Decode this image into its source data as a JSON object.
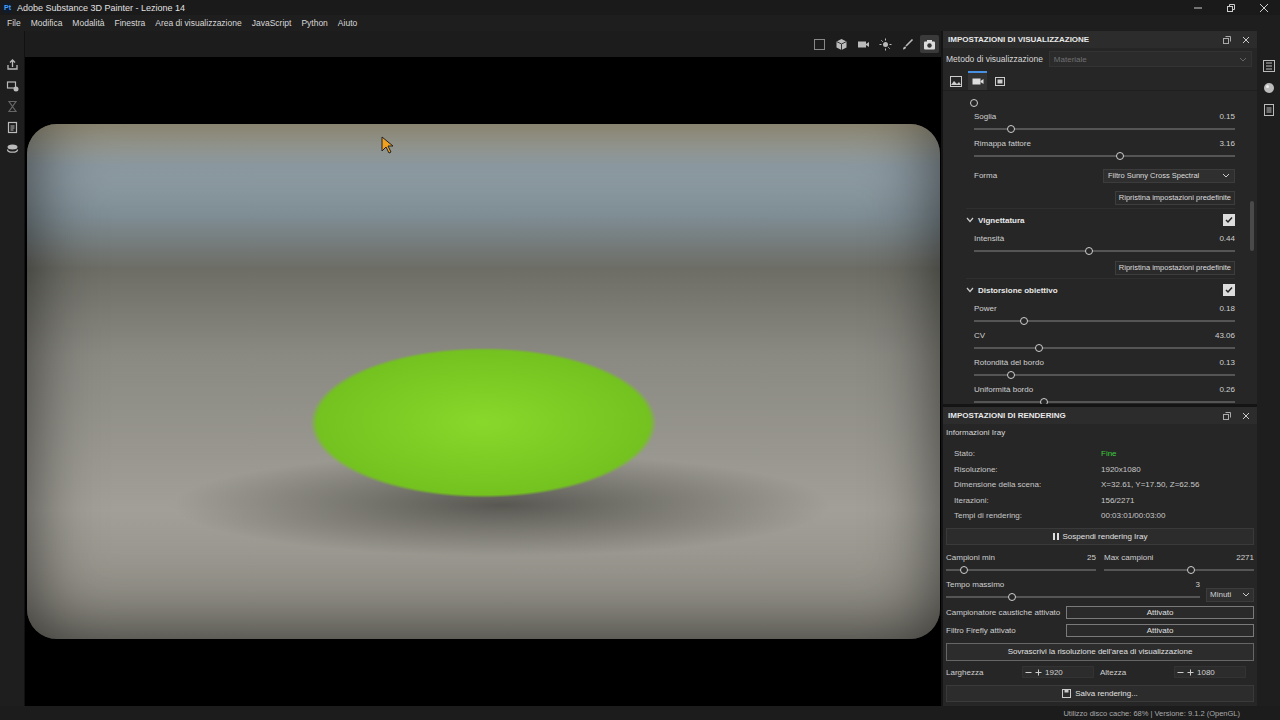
{
  "window": {
    "title": "Adobe Substance 3D Painter - Lezione 14",
    "app_badge": "Pt"
  },
  "menu": [
    "File",
    "Modifica",
    "Modalità",
    "Finestra",
    "Area di visualizzazione",
    "JavaScript",
    "Python",
    "Aiuto"
  ],
  "viewport_tools": [
    {
      "selected": false
    },
    {
      "selected": false
    },
    {
      "selected": false
    },
    {
      "selected": false
    },
    {
      "selected": false
    },
    {
      "selected": true
    }
  ],
  "display_settings": {
    "title": "IMPOSTAZIONI DI VISUALIZZAZIONE",
    "method_label": "Metodo di visualizzazione",
    "method_value": "Materiale",
    "method_disabled": true,
    "tabs": [
      {
        "selected": false
      },
      {
        "selected": true
      },
      {
        "selected": false
      }
    ],
    "items": [
      {
        "kind": "track",
        "level": 0.2
      },
      {
        "kind": "slider",
        "label": "Soglia",
        "value": "0.15",
        "level": 0.14
      },
      {
        "kind": "slider",
        "label": "Rimappa fattore",
        "value": "3.16",
        "level": 0.56
      },
      {
        "kind": "select",
        "label": "Forma",
        "value": "Filtro Sunny Cross Spectral"
      },
      {
        "kind": "button",
        "label": "Ripristina impostazioni predefinite"
      },
      {
        "kind": "section",
        "label": "Vignettatura",
        "checked": true,
        "expanded": true
      },
      {
        "kind": "slider",
        "label": "Intensità",
        "value": "0.44",
        "level": 0.44
      },
      {
        "kind": "button",
        "label": "Ripristina impostazioni predefinite"
      },
      {
        "kind": "section",
        "label": "Distorsione obiettivo",
        "checked": true,
        "expanded": true
      },
      {
        "kind": "slider",
        "label": "Power",
        "value": "0.18",
        "level": 0.19
      },
      {
        "kind": "slider",
        "label": "CV",
        "value": "43.06",
        "level": 0.25
      },
      {
        "kind": "slider",
        "label": "Rotondità del bordo",
        "value": "0.13",
        "level": 0.14
      },
      {
        "kind": "slider",
        "label": "Uniformità bordo",
        "value": "0.26",
        "level": 0.27
      }
    ]
  },
  "render_settings": {
    "title": "IMPOSTAZIONI DI RENDERING",
    "info_title": "Informazioni Iray",
    "info": [
      {
        "label": "Stato:",
        "value": "Fine",
        "color": "#3ccc3c"
      },
      {
        "label": "Risoluzione:",
        "value": "1920x1080",
        "color": "#c8c8c8"
      },
      {
        "label": "Dimensione della scena:",
        "value": "X=32.61, Y=17.50, Z=62.56",
        "color": "#c8c8c8"
      },
      {
        "label": "Iterazioni:",
        "value": "156/2271",
        "color": "#c8c8c8"
      },
      {
        "label": "Tempi di rendering:",
        "value": "00:03:01/00:03:00",
        "color": "#c8c8c8"
      }
    ],
    "pause_button": "Sospendi rendering Iray",
    "min_samples": {
      "label": "Campioni min",
      "value": "25",
      "level": 0.12
    },
    "max_samples": {
      "label": "Max campioni",
      "value": "2271",
      "level": 0.58
    },
    "max_time": {
      "label": "Tempo massimo",
      "value": "3",
      "level": 0.26,
      "unit": "Minuti"
    },
    "toggles": [
      {
        "label": "Campionatore caustiche attivato",
        "button": "Attivato",
        "on": true
      },
      {
        "label": "Filtro Firefly attivato",
        "button": "Attivato",
        "on": true
      }
    ],
    "override_button": "Sovrascrivi la risoluzione dell'area di visualizzazione",
    "width": {
      "label": "Larghezza",
      "value": "1920"
    },
    "height": {
      "label": "Altezza",
      "value": "1080"
    },
    "save_button": "Salva rendering..."
  },
  "status_bar": "Utilizzo disco cache: 68% | Versione: 9.1.2 (OpenGL)"
}
